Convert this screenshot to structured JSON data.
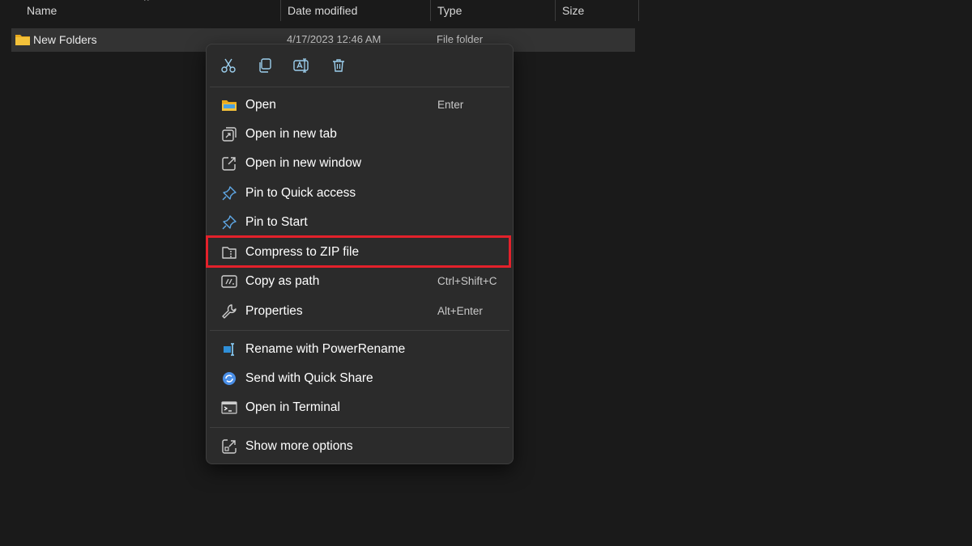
{
  "columns": {
    "name": "Name",
    "date_modified": "Date modified",
    "type": "Type",
    "size": "Size"
  },
  "file": {
    "name": "New Folders",
    "date_modified": "4/17/2023 12:46 AM",
    "type": "File folder",
    "icon": "folder-icon"
  },
  "quick_actions": [
    {
      "name": "cut",
      "icon": "scissors-icon"
    },
    {
      "name": "copy",
      "icon": "copy-icon"
    },
    {
      "name": "rename",
      "icon": "rename-icon"
    },
    {
      "name": "delete",
      "icon": "trash-icon"
    }
  ],
  "menu": {
    "items": [
      {
        "label": "Open",
        "shortcut": "Enter",
        "icon": "folder-open-icon"
      },
      {
        "label": "Open in new tab",
        "shortcut": "",
        "icon": "new-tab-icon"
      },
      {
        "label": "Open in new window",
        "shortcut": "",
        "icon": "new-window-icon"
      },
      {
        "label": "Pin to Quick access",
        "shortcut": "",
        "icon": "pin-icon"
      },
      {
        "label": "Pin to Start",
        "shortcut": "",
        "icon": "pin-icon"
      },
      {
        "label": "Compress to ZIP file",
        "shortcut": "",
        "icon": "zip-icon",
        "highlighted": true
      },
      {
        "label": "Copy as path",
        "shortcut": "Ctrl+Shift+C",
        "icon": "copy-path-icon"
      },
      {
        "label": "Properties",
        "shortcut": "Alt+Enter",
        "icon": "wrench-icon"
      },
      {
        "label": "Rename with PowerRename",
        "shortcut": "",
        "icon": "powerrename-icon"
      },
      {
        "label": "Send with Quick Share",
        "shortcut": "",
        "icon": "quick-share-icon"
      },
      {
        "label": "Open in Terminal",
        "shortcut": "",
        "icon": "terminal-icon"
      },
      {
        "label": "Show more options",
        "shortcut": "",
        "icon": "more-options-icon"
      }
    ]
  },
  "colors": {
    "accent": "#60cdff",
    "highlight_border": "#e3212b",
    "folder": "#f3c13a",
    "background": "#1a1a1a",
    "menu_background": "#2b2b2b"
  }
}
